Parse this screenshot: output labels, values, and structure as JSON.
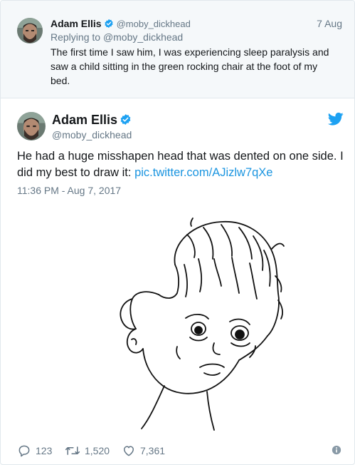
{
  "reply_tweet": {
    "author_name": "Adam Ellis",
    "handle": "@moby_dickhead",
    "date": "7 Aug",
    "replying_prefix": "Replying to",
    "replying_to": "@moby_dickhead",
    "text": "The first time I saw him, I was experiencing sleep paralysis and saw a child sitting in the green rocking chair at the foot of my bed."
  },
  "main_tweet": {
    "author_name": "Adam Ellis",
    "handle": "@moby_dickhead",
    "text": "He had a huge misshapen head that was dented on one side. I did my best to draw it: ",
    "link": "pic.twitter.com/AJizlw7qXe",
    "timestamp": "11:36 PM - Aug 7, 2017"
  },
  "actions": {
    "replies": "123",
    "retweets": "1,520",
    "likes": "7,361"
  },
  "colors": {
    "link_blue": "#1b95e0",
    "verified_blue": "#1da1f2",
    "muted": "#657786",
    "reply_bg": "#f5f8fa",
    "border": "#e1e8ed"
  },
  "icons": [
    "verified-badge-icon",
    "twitter-bird-icon",
    "reply-icon",
    "retweet-icon",
    "like-icon",
    "info-icon"
  ]
}
